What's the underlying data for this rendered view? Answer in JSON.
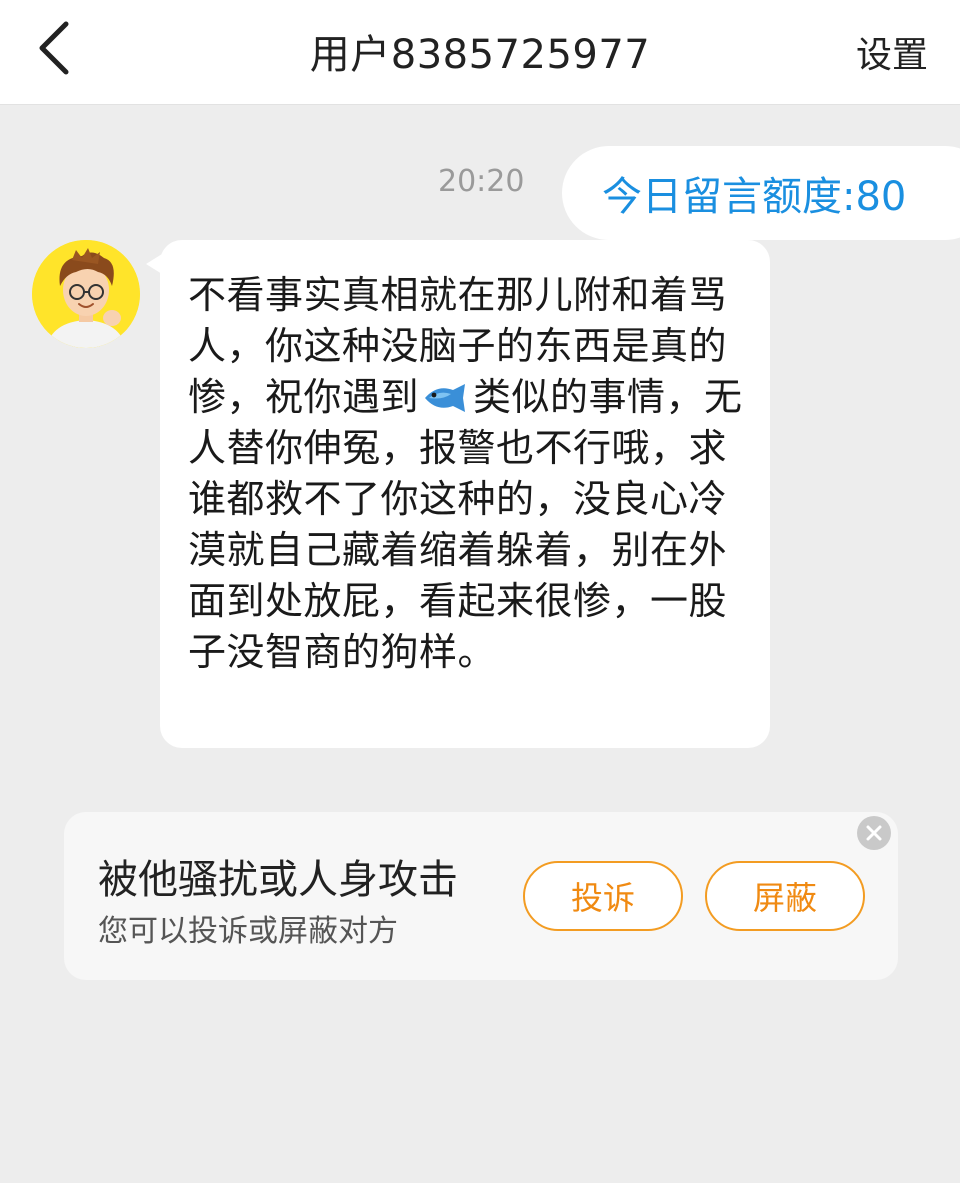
{
  "header": {
    "title": "用户8385725977",
    "settings_label": "设置"
  },
  "chat": {
    "timestamp": "20:20",
    "quota_label": "今日留言额度:80",
    "message": {
      "text_before_emoji": "不看事实真相就在那儿附和着骂人，你这种没脑子的东西是真的惨，祝你遇到",
      "emoji": "fish-emoji",
      "text_after_emoji": "类似的事情，无人替你伸冤，报警也不行哦，求谁都救不了你这种的，没良心冷漠就自己藏着缩着躲着，别在外面到处放屁，看起来很惨，一股子没智商的狗样。"
    }
  },
  "report_card": {
    "title": "被他骚扰或人身攻击",
    "subtitle": "您可以投诉或屏蔽对方",
    "complain_label": "投诉",
    "block_label": "屏蔽"
  },
  "colors": {
    "accent_blue": "#1a8fe0",
    "accent_orange": "#f39c22",
    "background": "#ededed"
  }
}
